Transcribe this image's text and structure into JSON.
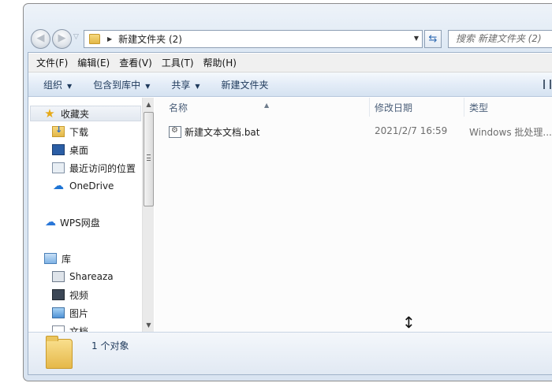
{
  "address": {
    "current_folder": "新建文件夹 (2)",
    "search_placeholder": "搜索 新建文件夹 (2)"
  },
  "menu": {
    "items": [
      "文件(F)",
      "编辑(E)",
      "查看(V)",
      "工具(T)",
      "帮助(H)"
    ]
  },
  "toolbar": {
    "organize": "组织",
    "include_in_library": "包含到库中",
    "share": "共享",
    "new_folder": "新建文件夹"
  },
  "nav": {
    "favorites": "收藏夹",
    "downloads": "下载",
    "desktop": "桌面",
    "recent": "最近访问的位置",
    "onedrive": "OneDrive",
    "wps": "WPS网盘",
    "libraries": "库",
    "shareaza": "Shareaza",
    "videos": "视频",
    "pictures": "图片",
    "documents": "文档"
  },
  "columns": {
    "name": "名称",
    "date": "修改日期",
    "type": "类型"
  },
  "files": [
    {
      "name": "新建文本文档.bat",
      "date": "2021/2/7 16:59",
      "type": "Windows 批处理..."
    }
  ],
  "status": {
    "count": "1 个对象"
  }
}
